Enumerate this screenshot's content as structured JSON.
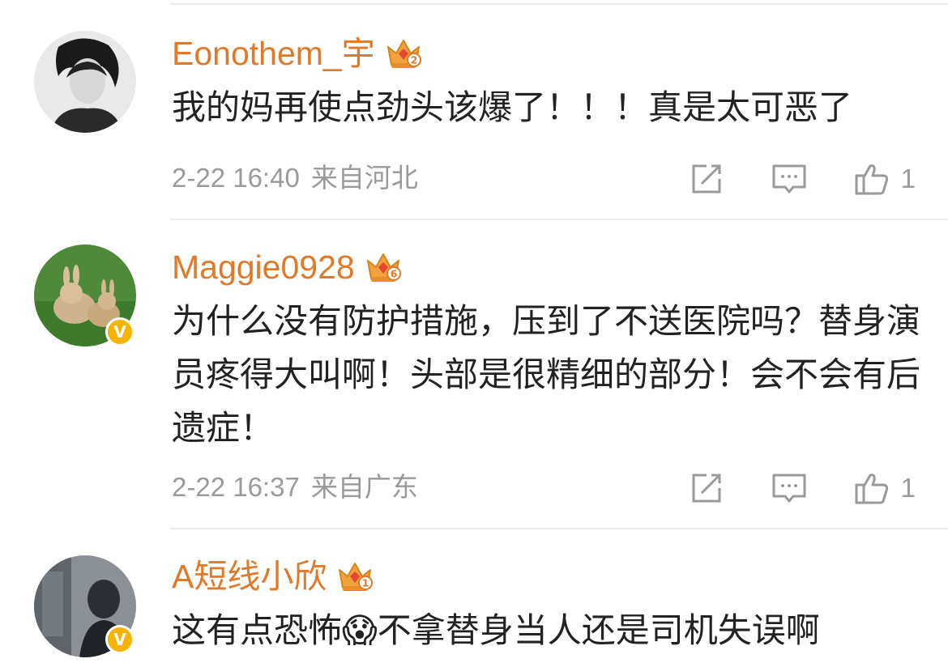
{
  "comments": [
    {
      "username": "Eonothem_宇",
      "level_badge": "2",
      "text": "我的妈再使点劲头该爆了！！！真是太可恶了",
      "time": "2-22 16:40",
      "location": "来自河北",
      "likes": "1",
      "verified": false
    },
    {
      "username": "Maggie0928",
      "level_badge": "6",
      "text": "为什么没有防护措施，压到了不送医院吗？替身演员疼得大叫啊！头部是很精细的部分！会不会有后遗症！",
      "time": "2-22 16:37",
      "location": "来自广东",
      "likes": "1",
      "verified": true
    },
    {
      "username": "A短线小欣",
      "level_badge": "1",
      "text": "这有点恐怖😱不拿替身当人还是司机失误啊",
      "verified": true
    }
  ],
  "icons": {
    "repost": "repost-icon",
    "reply": "reply-icon",
    "like": "thumbs-up-icon",
    "crown": "crown-badge-icon",
    "verified": "verified-v-badge"
  },
  "verified_badge_text": "V",
  "colors": {
    "username": "#e07a2b",
    "meta": "#9a9a9a",
    "text": "#222222",
    "verified": "#f5b400",
    "crown": "#f2a23c"
  }
}
